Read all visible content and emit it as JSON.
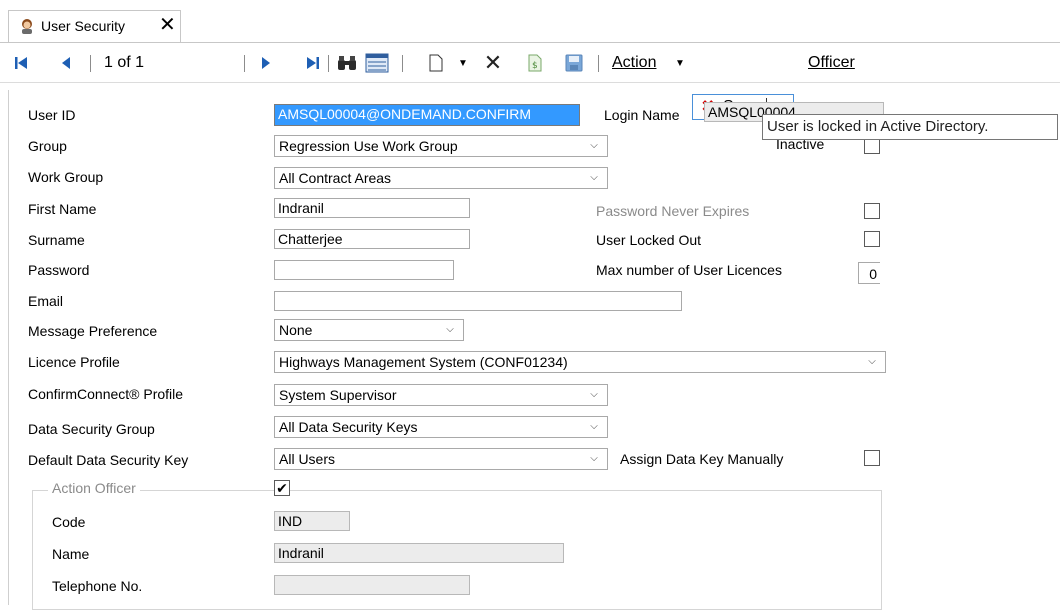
{
  "tab": {
    "icon": "user-avatar-icon",
    "title": "User Security",
    "close": "✕"
  },
  "toolbar": {
    "record_position": "1 of 1",
    "action_label": "Action",
    "sync_label": "Sync",
    "officer_label": "Officer"
  },
  "form": {
    "user_id": {
      "label": "User ID",
      "value": "AMSQL00004@ONDEMAND.CONFIRM"
    },
    "login_name": {
      "label": "Login Name",
      "value": "AMSQL00004"
    },
    "group": {
      "label": "Group",
      "value": "Regression Use Work Group"
    },
    "inactive": {
      "label": "Inactive",
      "checked": false
    },
    "work_group": {
      "label": "Work Group",
      "value": "All Contract Areas"
    },
    "first_name": {
      "label": "First Name",
      "value": "Indranil"
    },
    "surname": {
      "label": "Surname",
      "value": "Chatterjee"
    },
    "password": {
      "label": "Password",
      "value": ""
    },
    "email": {
      "label": "Email",
      "value": ""
    },
    "password_never_expires": {
      "label": "Password Never Expires",
      "checked": false
    },
    "user_locked_out": {
      "label": "User Locked Out",
      "checked": false
    },
    "max_user_licences": {
      "label": "Max number of User Licences",
      "value": "0"
    },
    "message_preference": {
      "label": "Message Preference",
      "value": "None"
    },
    "licence_profile": {
      "label": "Licence Profile",
      "value": "Highways Management System (CONF01234)"
    },
    "confirmconnect_profile": {
      "label": "ConfirmConnect® Profile",
      "value": "System Supervisor"
    },
    "data_security_group": {
      "label": "Data Security Group",
      "value": "All Data Security Keys"
    },
    "default_data_security_key": {
      "label": "Default Data Security Key",
      "value": "All Users"
    },
    "assign_data_key_manually": {
      "label": "Assign Data Key Manually",
      "checked": false
    },
    "action_officer": {
      "group_label": "Action Officer",
      "checked": true,
      "code": {
        "label": "Code",
        "value": "IND"
      },
      "name": {
        "label": "Name",
        "value": "Indranil"
      },
      "telephone": {
        "label": "Telephone No.",
        "value": ""
      }
    }
  },
  "tooltip": {
    "text": "User is locked in Active Directory."
  },
  "colors": {
    "selection": "#3399ff",
    "nav_blue": "#1e5fb4",
    "delete_red": "#d00000"
  }
}
